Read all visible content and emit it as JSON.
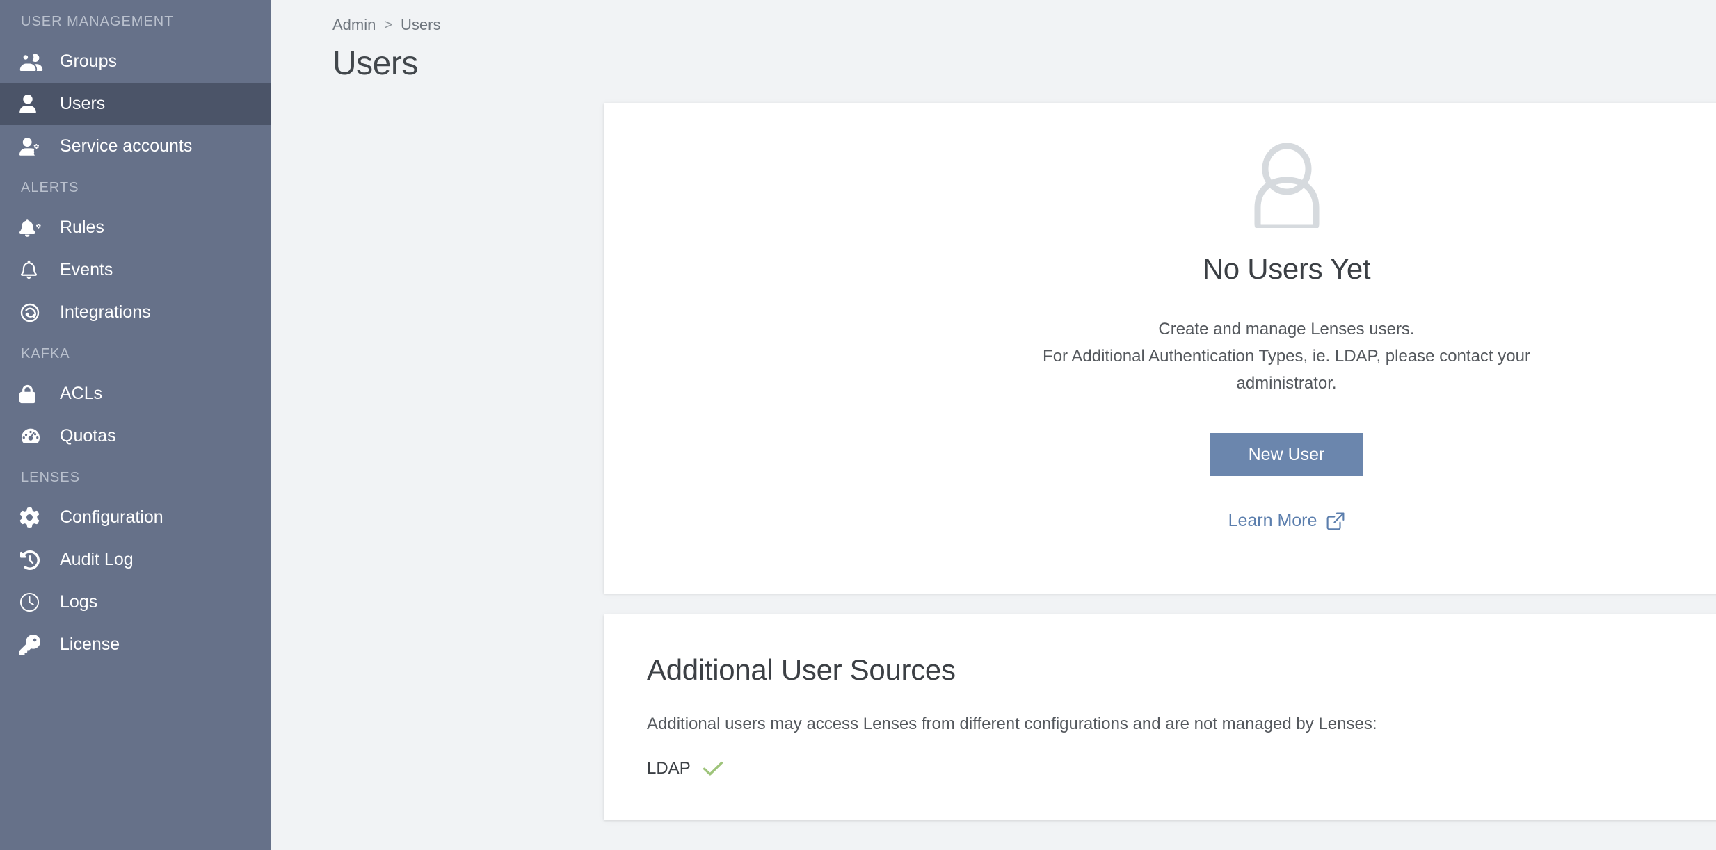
{
  "sidebar": {
    "sections": [
      {
        "title": "USER MANAGEMENT",
        "items": [
          {
            "label": "Groups",
            "icon": "users-group-icon",
            "active": false
          },
          {
            "label": "Users",
            "icon": "user-icon",
            "active": true
          },
          {
            "label": "Service accounts",
            "icon": "user-gear-icon",
            "active": false
          }
        ]
      },
      {
        "title": "ALERTS",
        "items": [
          {
            "label": "Rules",
            "icon": "bell-gear-icon",
            "active": false
          },
          {
            "label": "Events",
            "icon": "bell-icon",
            "active": false
          },
          {
            "label": "Integrations",
            "icon": "integrations-icon",
            "active": false
          }
        ]
      },
      {
        "title": "KAFKA",
        "items": [
          {
            "label": "ACLs",
            "icon": "lock-icon",
            "active": false
          },
          {
            "label": "Quotas",
            "icon": "gauge-icon",
            "active": false
          }
        ]
      },
      {
        "title": "LENSES",
        "items": [
          {
            "label": "Configuration",
            "icon": "gear-icon",
            "active": false
          },
          {
            "label": "Audit Log",
            "icon": "history-icon",
            "active": false
          },
          {
            "label": "Logs",
            "icon": "clock-icon",
            "active": false
          },
          {
            "label": "License",
            "icon": "key-icon",
            "active": false
          }
        ]
      }
    ]
  },
  "breadcrumb": {
    "parent": "Admin",
    "separator": ">",
    "current": "Users"
  },
  "page": {
    "title": "Users"
  },
  "empty_state": {
    "avatar_icon": "user-avatar-icon",
    "title": "No Users Yet",
    "description_line1": "Create and manage Lenses users.",
    "description_line2": "For Additional Authentication Types, ie. LDAP, please contact your administrator.",
    "new_user_label": "New User",
    "learn_more_label": "Learn More",
    "learn_more_icon": "external-link-icon"
  },
  "sources": {
    "title": "Additional User Sources",
    "description": "Additional users may access Lenses from different configurations and are not managed by Lenses:",
    "items": [
      {
        "name": "LDAP",
        "enabled": true,
        "icon": "check-icon"
      }
    ]
  },
  "colors": {
    "sidebar_bg": "#667189",
    "sidebar_active": "#4b5468",
    "page_bg": "#f1f3f5",
    "card_bg": "#ffffff",
    "primary_button": "#6b86ad",
    "link": "#5b7ead",
    "check_green": "#9ec47a"
  }
}
